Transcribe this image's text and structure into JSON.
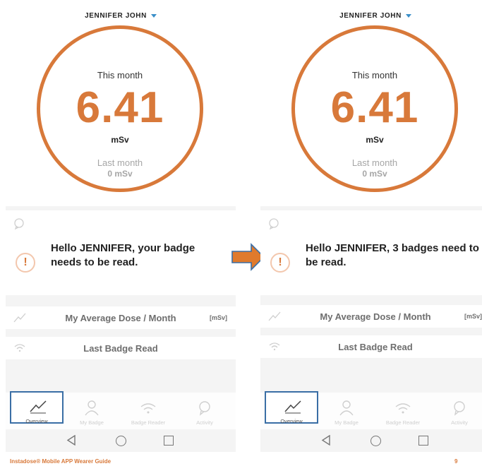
{
  "colors": {
    "accent": "#d8793a",
    "nav_active_border": "#3a6ea5",
    "caret": "#3a8fc8"
  },
  "screens": [
    {
      "user_name": "JENNIFER  JOHN",
      "dose": {
        "this_month_label": "This month",
        "value": "6.41",
        "unit": "mSv",
        "last_month_label": "Last month",
        "last_month_value": "0 mSv"
      },
      "notification": "Hello JENNIFER, your badge needs to be read.",
      "cards": {
        "average": "My Average Dose / Month",
        "average_unit": "[mSv]",
        "last_read": "Last Badge Read"
      },
      "nav": [
        "Overview",
        "My Badge",
        "Badge Reader",
        "Activity"
      ]
    },
    {
      "user_name": "JENNIFER  JOHN",
      "dose": {
        "this_month_label": "This month",
        "value": "6.41",
        "unit": "mSv",
        "last_month_label": "Last month",
        "last_month_value": "0 mSv"
      },
      "notification": "Hello JENNIFER, 3 badges need to be read.",
      "cards": {
        "average": "My Average Dose / Month",
        "average_unit": "[mSv]",
        "last_read": "Last Badge Read"
      },
      "nav": [
        "Overview",
        "My Badge",
        "Badge Reader",
        "Activity"
      ]
    }
  ],
  "footer": {
    "title": "Instadose® Mobile APP Wearer Guide",
    "page": "9"
  }
}
